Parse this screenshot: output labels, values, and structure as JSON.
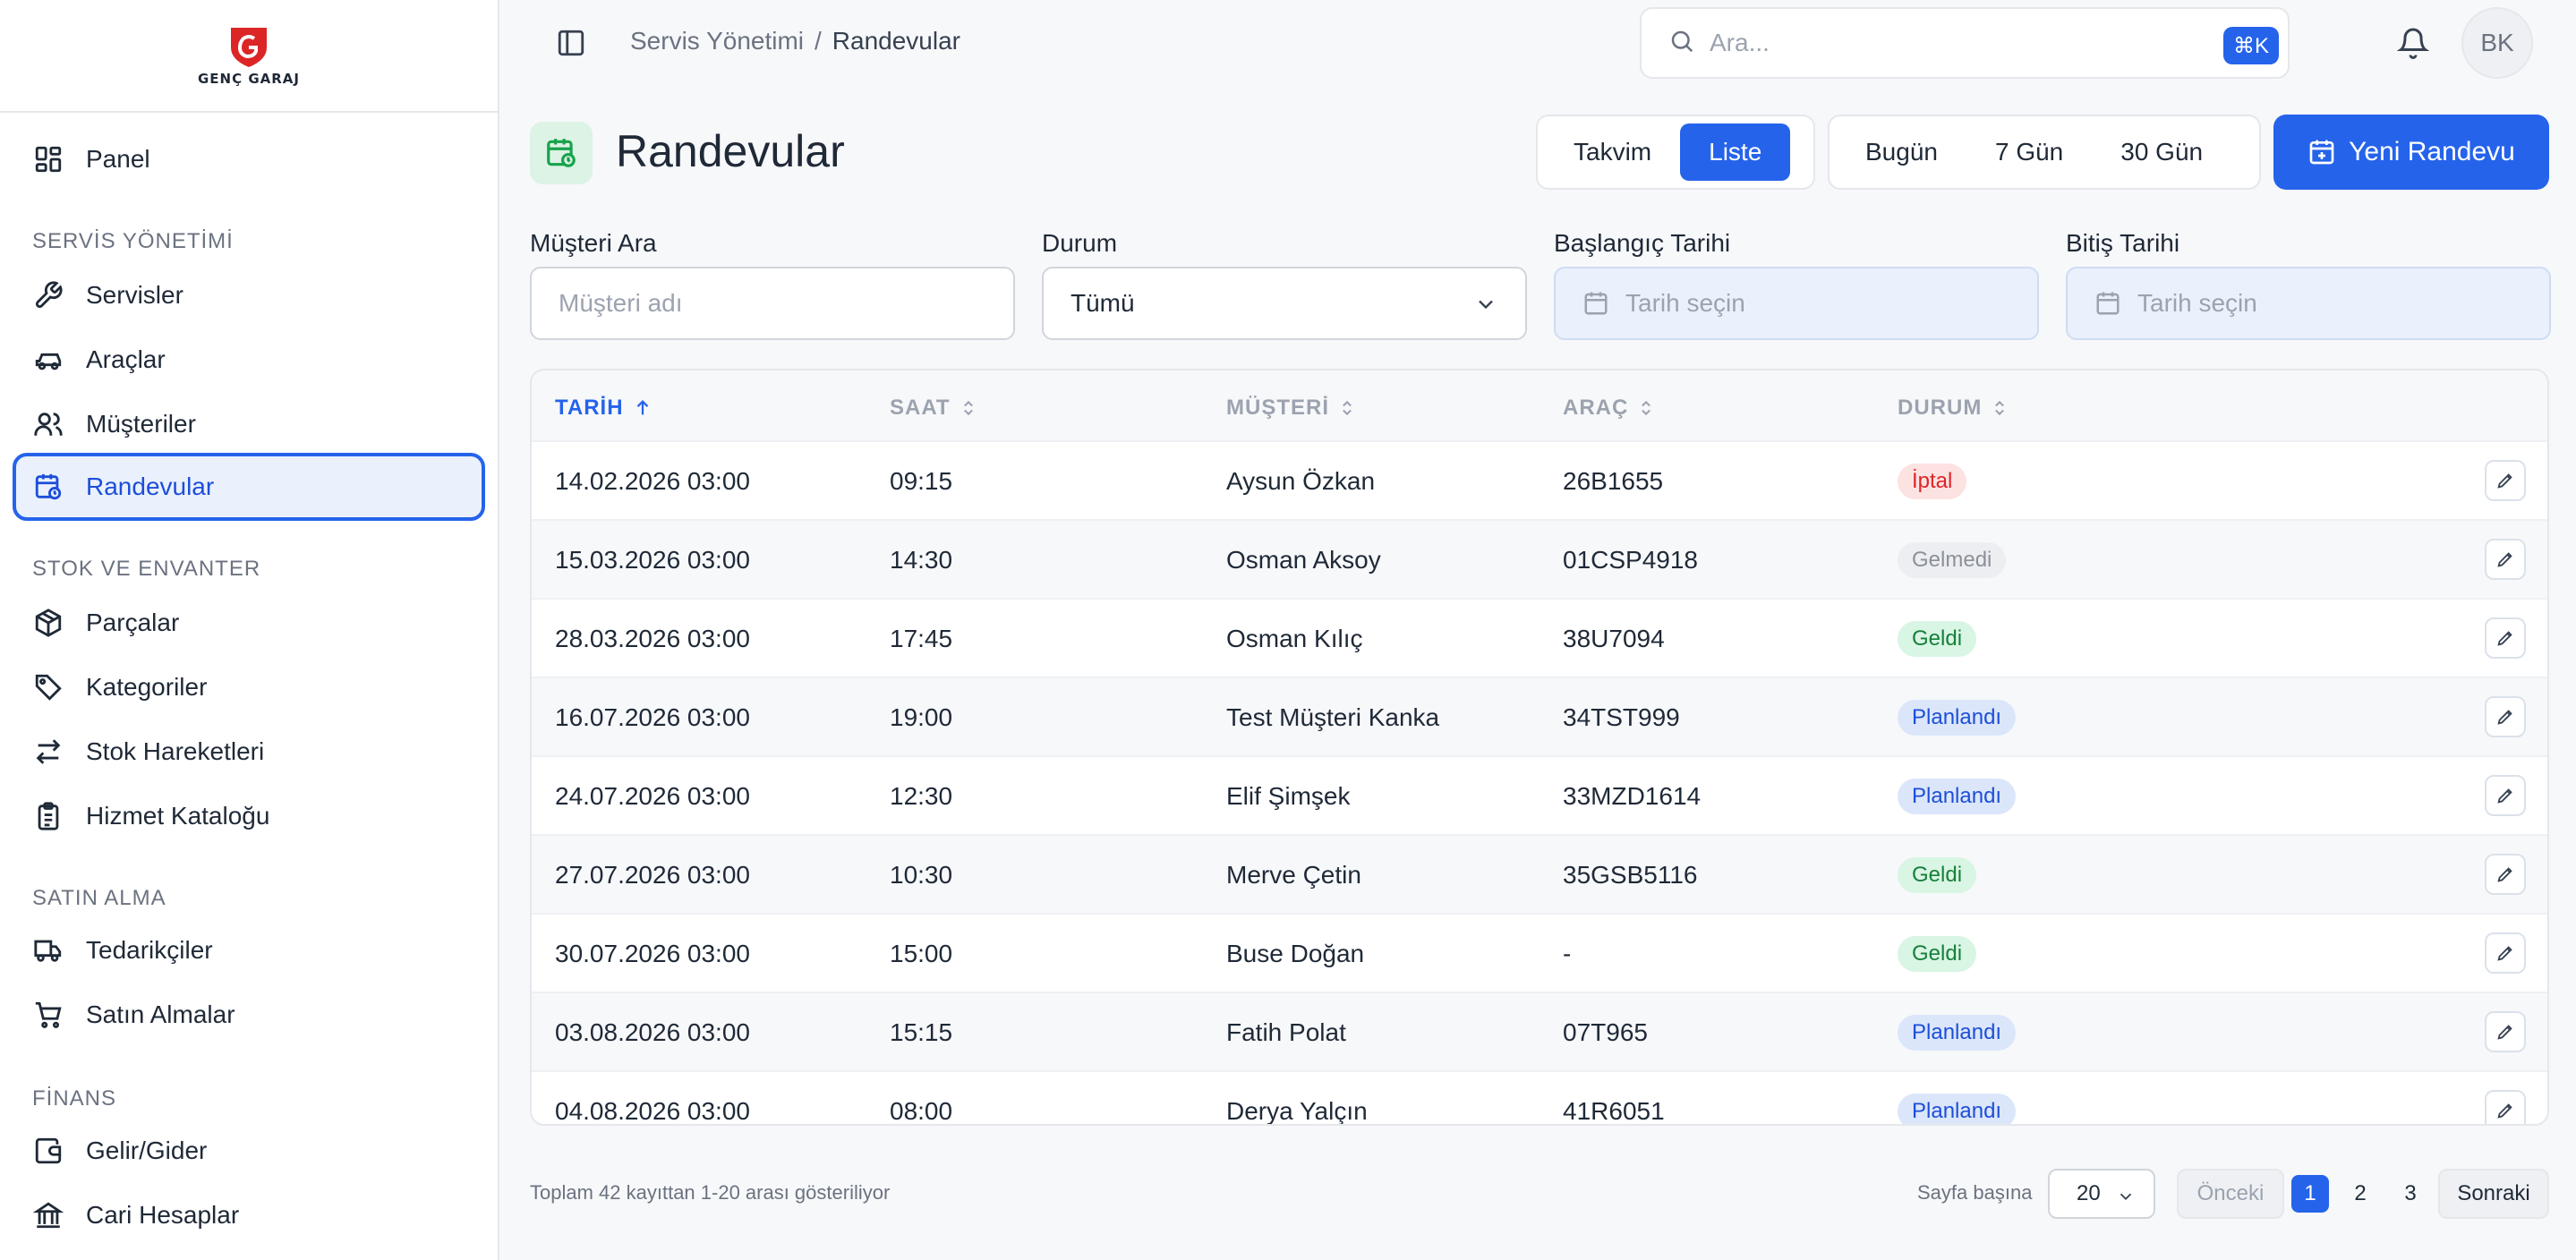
{
  "brand": {
    "logo_text": "GENÇ GARAJ"
  },
  "sidebar": {
    "panel": "Panel",
    "sections": {
      "servis": "SERVİS YÖNETİMİ",
      "stok": "STOK VE ENVANTER",
      "satin": "SATIN ALMA",
      "finans": "FİNANS"
    },
    "items": {
      "servisler": "Servisler",
      "araclar": "Araçlar",
      "musteriler": "Müşteriler",
      "randevular": "Randevular",
      "parcalar": "Parçalar",
      "kategoriler": "Kategoriler",
      "stok_hareketleri": "Stok Hareketleri",
      "hizmet_katalogu": "Hizmet Kataloğu",
      "tedarikciler": "Tedarikçiler",
      "satin_almalar": "Satın Almalar",
      "gelir_gider": "Gelir/Gider",
      "cari_hesaplar": "Cari Hesaplar"
    }
  },
  "header": {
    "breadcrumb_parent": "Servis Yönetimi",
    "breadcrumb_sep": "/",
    "breadcrumb_current": "Randevular",
    "search_placeholder": "Ara...",
    "search_shortcut": "⌘K",
    "avatar_initials": "BK"
  },
  "page": {
    "title": "Randevular",
    "view_toggle": {
      "takvim": "Takvim",
      "liste": "Liste",
      "active": "liste"
    },
    "range": {
      "bugun": "Bugün",
      "yedi": "7 Gün",
      "otuz": "30 Gün"
    },
    "new_button": "Yeni Randevu"
  },
  "filters": {
    "customer_label": "Müşteri Ara",
    "customer_placeholder": "Müşteri adı",
    "status_label": "Durum",
    "status_value": "Tümü",
    "start_label": "Başlangıç Tarihi",
    "start_placeholder": "Tarih seçin",
    "end_label": "Bitiş Tarihi",
    "end_placeholder": "Tarih seçin"
  },
  "table": {
    "columns": {
      "tarih": "TARİH",
      "saat": "SAAT",
      "musteri": "MÜŞTERİ",
      "arac": "ARAÇ",
      "durum": "DURUM"
    },
    "rows": [
      {
        "tarih": "14.02.2026 03:00",
        "saat": "09:15",
        "musteri": "Aysun Özkan",
        "arac": "26B1655",
        "durum": "İptal",
        "status_class": "iptal"
      },
      {
        "tarih": "15.03.2026 03:00",
        "saat": "14:30",
        "musteri": "Osman Aksoy",
        "arac": "01CSP4918",
        "durum": "Gelmedi",
        "status_class": "gelmedi"
      },
      {
        "tarih": "28.03.2026 03:00",
        "saat": "17:45",
        "musteri": "Osman Kılıç",
        "arac": "38U7094",
        "durum": "Geldi",
        "status_class": "geldi"
      },
      {
        "tarih": "16.07.2026 03:00",
        "saat": "19:00",
        "musteri": "Test Müşteri Kanka",
        "arac": "34TST999",
        "durum": "Planlandı",
        "status_class": "planlandi"
      },
      {
        "tarih": "24.07.2026 03:00",
        "saat": "12:30",
        "musteri": "Elif Şimşek",
        "arac": "33MZD1614",
        "durum": "Planlandı",
        "status_class": "planlandi"
      },
      {
        "tarih": "27.07.2026 03:00",
        "saat": "10:30",
        "musteri": "Merve Çetin",
        "arac": "35GSB5116",
        "durum": "Geldi",
        "status_class": "geldi"
      },
      {
        "tarih": "30.07.2026 03:00",
        "saat": "15:00",
        "musteri": "Buse Doğan",
        "arac": "-",
        "durum": "Geldi",
        "status_class": "geldi"
      },
      {
        "tarih": "03.08.2026 03:00",
        "saat": "15:15",
        "musteri": "Fatih Polat",
        "arac": "07T965",
        "durum": "Planlandı",
        "status_class": "planlandi"
      },
      {
        "tarih": "04.08.2026 03:00",
        "saat": "08:00",
        "musteri": "Derya Yalçın",
        "arac": "41R6051",
        "durum": "Planlandı",
        "status_class": "planlandi"
      }
    ]
  },
  "pagination": {
    "summary": "Toplam 42 kayıttan 1-20 arası gösteriliyor",
    "per_page_label": "Sayfa başına",
    "per_page_value": "20",
    "prev": "Önceki",
    "pages": [
      "1",
      "2",
      "3"
    ],
    "current_page": "1",
    "next": "Sonraki"
  },
  "colors": {
    "accent": "#2563eb",
    "status_iptal": "#dc2626",
    "status_geldi": "#16803a",
    "status_planlandi": "#1d4ed8",
    "status_gelmedi": "#8b9099",
    "logo_red": "#dc2626"
  },
  "icons": {
    "panel": "grid-icon",
    "servisler": "wrench-icon",
    "araclar": "car-icon",
    "musteriler": "users-icon",
    "randevular": "calendar-clock-icon",
    "parcalar": "box-icon",
    "kategoriler": "tag-icon",
    "stok_hareketleri": "arrows-left-right-icon",
    "hizmet_katalogu": "clipboard-list-icon",
    "tedarikciler": "truck-icon",
    "satin_almalar": "cart-icon",
    "gelir_gider": "wallet-icon",
    "cari_hesaplar": "bank-icon"
  }
}
